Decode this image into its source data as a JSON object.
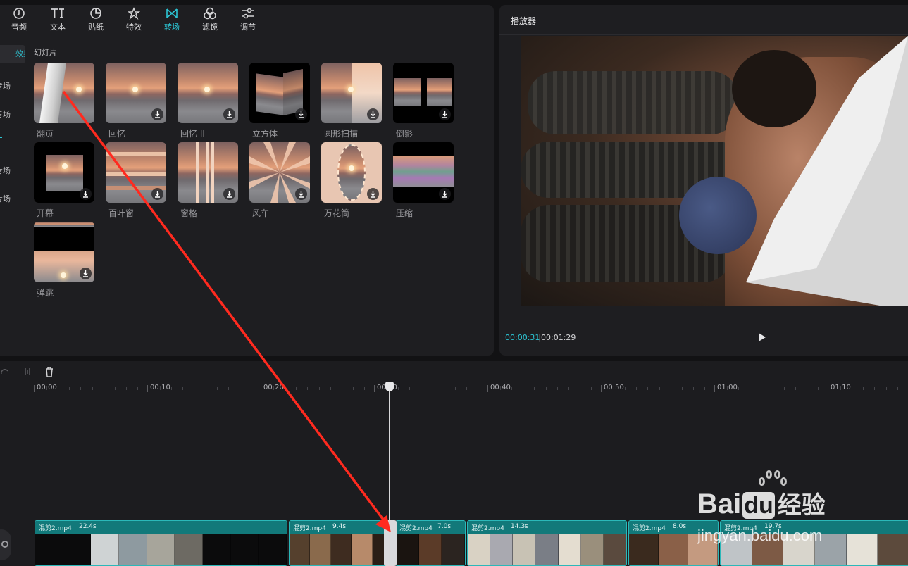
{
  "toolbar": {
    "tabs": [
      {
        "label": "音频",
        "icon": "audio-icon"
      },
      {
        "label": "文本",
        "icon": "text-icon"
      },
      {
        "label": "贴纸",
        "icon": "sticker-icon"
      },
      {
        "label": "特效",
        "icon": "effects-icon"
      },
      {
        "label": "转场",
        "icon": "transition-icon",
        "active": true
      },
      {
        "label": "滤镜",
        "icon": "filter-icon"
      },
      {
        "label": "调节",
        "icon": "adjust-icon"
      }
    ]
  },
  "categories": [
    "效果",
    "专场",
    "专场",
    "专场",
    "专场"
  ],
  "section_title": "幻灯片",
  "transitions": [
    {
      "label": "翻页",
      "download": false
    },
    {
      "label": "回忆",
      "download": true
    },
    {
      "label": "回忆 II",
      "download": true
    },
    {
      "label": "立方体",
      "download": true
    },
    {
      "label": "圆形扫描",
      "download": true
    },
    {
      "label": "倒影",
      "download": true
    },
    {
      "label": "开幕",
      "download": true
    },
    {
      "label": "百叶窗",
      "download": true
    },
    {
      "label": "窗格",
      "download": true
    },
    {
      "label": "风车",
      "download": true
    },
    {
      "label": "万花筒",
      "download": true
    },
    {
      "label": "压缩",
      "download": true
    },
    {
      "label": "弹跳",
      "download": true
    }
  ],
  "player": {
    "title": "播放器",
    "current_time": "00:00:31",
    "separator": "|",
    "total_time": "00:01:29"
  },
  "timeline": {
    "ruler_labels": [
      "00:00",
      "00:10",
      "00:20",
      "00:30",
      "00:40",
      "00:50",
      "01:00",
      "01:10"
    ],
    "clips": [
      {
        "name": "混剪2.mp4",
        "duration": "22.4s"
      },
      {
        "name": "混剪2.mp4",
        "duration": "9.4s"
      },
      {
        "name": "混剪2.mp4",
        "duration": "7.0s"
      },
      {
        "name": "混剪2.mp4",
        "duration": "14.3s"
      },
      {
        "name": "混剪2.mp4",
        "duration": "8.0s"
      },
      {
        "name": "混剪2.mp4",
        "duration": "19.7s"
      }
    ]
  },
  "watermark": {
    "brand": "Bai",
    "brand2": "du",
    "cn": "经验",
    "url": "jingyan.baidu.com"
  },
  "colors": {
    "accent": "#2cc5d4",
    "clip_header": "#12797a",
    "arrow": "#ff2a1f"
  }
}
